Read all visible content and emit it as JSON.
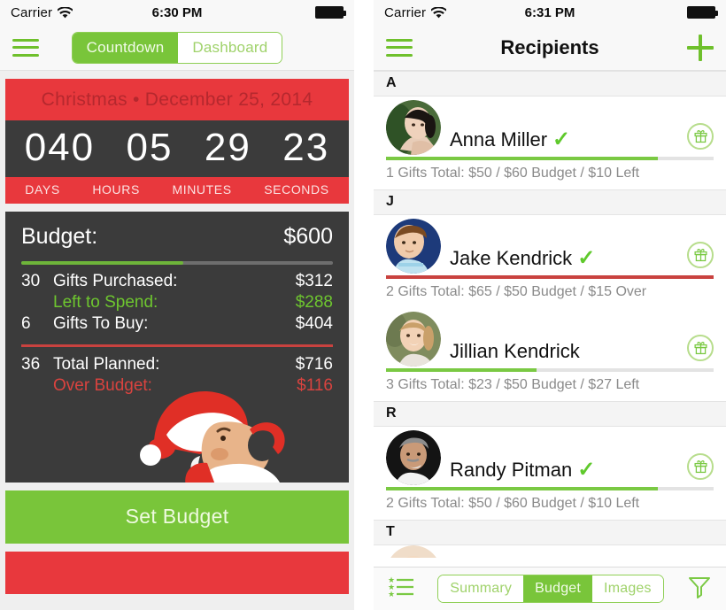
{
  "colors": {
    "brand_green": "#79c53a",
    "light_green": "#9fd26a",
    "accent_red": "#e8383d",
    "dark_panel": "#3b3b3b",
    "over_budget_red": "#d9433f",
    "left_to_spend_green": "#6ec62f"
  },
  "left_phone": {
    "status_bar": {
      "carrier": "Carrier",
      "wifi_icon": "wifi-icon",
      "time": "6:30 PM",
      "battery_icon": "battery-icon"
    },
    "nav": {
      "menu_icon": "hamburger-icon",
      "segments": [
        {
          "label": "Countdown",
          "active": true
        },
        {
          "label": "Dashboard",
          "active": false
        }
      ]
    },
    "countdown": {
      "title": "Christmas • December 25, 2014",
      "units": [
        {
          "value": "040",
          "label": "DAYS"
        },
        {
          "value": "05",
          "label": "HOURS"
        },
        {
          "value": "29",
          "label": "MINUTES"
        },
        {
          "value": "23",
          "label": "SECONDS"
        }
      ]
    },
    "budget": {
      "header_label": "Budget:",
      "header_value": "$600",
      "progress_percent": 52,
      "rows": [
        {
          "count": "30",
          "name": "Gifts Purchased:",
          "amount": "$312",
          "style": "white"
        },
        {
          "count": "",
          "name": "Left to Spend:",
          "amount": "$288",
          "style": "green"
        },
        {
          "count": "6",
          "name": "Gifts To Buy:",
          "amount": "$404",
          "style": "white"
        }
      ],
      "total_rows": [
        {
          "count": "36",
          "name": "Total Planned:",
          "amount": "$716",
          "style": "white"
        },
        {
          "count": "",
          "name": "Over Budget:",
          "amount": "$116",
          "style": "red"
        }
      ],
      "illustration": "santa-illustration"
    },
    "set_budget_button": "Set Budget"
  },
  "right_phone": {
    "status_bar": {
      "carrier": "Carrier",
      "wifi_icon": "wifi-icon",
      "time": "6:31 PM",
      "battery_icon": "battery-icon"
    },
    "nav": {
      "menu_icon": "hamburger-icon",
      "title": "Recipients",
      "add_icon": "plus-icon"
    },
    "sections": [
      {
        "letter": "A",
        "recipients": [
          {
            "name": "Anna Miller",
            "has_check": true,
            "gift_icon": "gift-icon",
            "subtitle": "1 Gifts Total: $50 / $60 Budget / $10 Left",
            "bar_percent": 83,
            "bar_color": "#7ac943",
            "avatar": "avatar-anna"
          }
        ]
      },
      {
        "letter": "J",
        "recipients": [
          {
            "name": "Jake Kendrick",
            "has_check": true,
            "gift_icon": "gift-icon",
            "subtitle": "2 Gifts Total: $65 / $50 Budget / $15 Over",
            "bar_percent": 100,
            "bar_color": "#c9423f",
            "avatar": "avatar-jake"
          },
          {
            "name": "Jillian Kendrick",
            "has_check": false,
            "gift_icon": "gift-icon",
            "subtitle": "3 Gifts Total: $23 / $50 Budget / $27 Left",
            "bar_percent": 46,
            "bar_color": "#7ac943",
            "avatar": "avatar-jillian"
          }
        ]
      },
      {
        "letter": "R",
        "recipients": [
          {
            "name": "Randy Pitman",
            "has_check": true,
            "gift_icon": "gift-icon",
            "subtitle": "2 Gifts Total: $50 / $60 Budget / $10 Left",
            "bar_percent": 83,
            "bar_color": "#7ac943",
            "avatar": "avatar-randy"
          }
        ]
      },
      {
        "letter": "T",
        "recipients": []
      }
    ],
    "toolbar": {
      "list_icon": "starred-list-icon",
      "segments": [
        {
          "label": "Summary",
          "active": false
        },
        {
          "label": "Budget",
          "active": true
        },
        {
          "label": "Images",
          "active": false
        }
      ],
      "filter_icon": "funnel-icon"
    }
  }
}
